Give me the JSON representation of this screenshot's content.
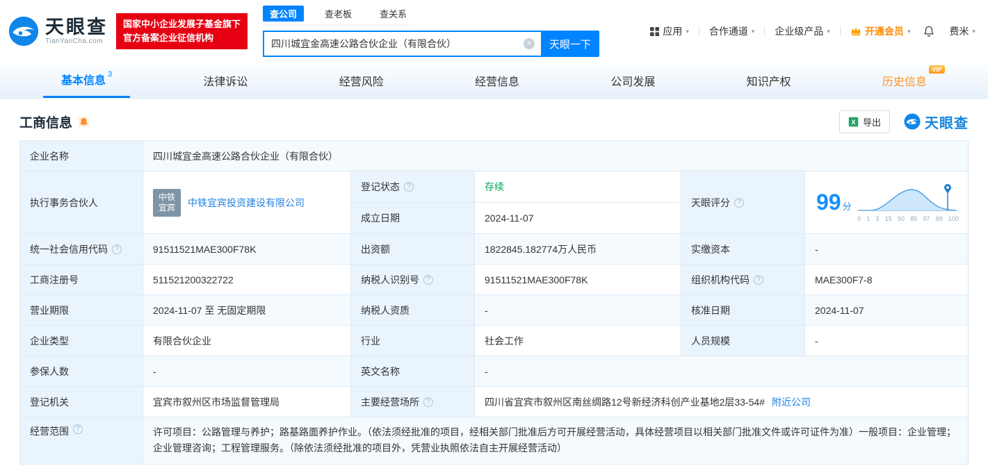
{
  "colors": {
    "brand_blue": "#0084ff",
    "link_blue": "#2382e0",
    "status_green": "#00a854",
    "badge_red": "#e60012",
    "vip_orange": "#ff9423"
  },
  "icons": {
    "caret_down": "▾",
    "clear": "×",
    "help": "?"
  },
  "header": {
    "logo": {
      "title": "天眼查",
      "subtitle": "TianYanCha.com"
    },
    "badge": {
      "line1": "国家中小企业发展子基金旗下",
      "line2": "官方备案企业征信机构"
    },
    "search": {
      "tabs": [
        {
          "label": "查公司"
        },
        {
          "label": "查老板"
        },
        {
          "label": "查关系"
        }
      ],
      "value": "四川城宜金高速公路合伙企业（有限合伙）",
      "button": "天眼一下"
    },
    "nav": {
      "apps": "应用",
      "cooperation": "合作通道",
      "enterprise_products": "企业级产品",
      "vip": "开通会员",
      "username": "费米"
    }
  },
  "tabs": {
    "basic": {
      "label": "基本信息",
      "badge": "3"
    },
    "legal": {
      "label": "法律诉讼"
    },
    "risk": {
      "label": "经营风险"
    },
    "operation": {
      "label": "经营信息"
    },
    "development": {
      "label": "公司发展"
    },
    "ip": {
      "label": "知识产权"
    },
    "history": {
      "label": "历史信息",
      "vip_badge": "VIP"
    }
  },
  "section": {
    "title": "工商信息",
    "export_label": "导出",
    "brand": "天眼查"
  },
  "info": {
    "company_name": {
      "label": "企业名称",
      "value": "四川城宜金高速公路合伙企业（有限合伙）"
    },
    "partner": {
      "label": "执行事务合伙人",
      "logo_line1": "中铁",
      "logo_line2": "宜宾",
      "value": "中铁宜宾投资建设有限公司"
    },
    "reg_status": {
      "label": "登记状态",
      "value": "存续"
    },
    "est_date": {
      "label": "成立日期",
      "value": "2024-11-07"
    },
    "score": {
      "label": "天眼评分",
      "value": "99",
      "unit": "分",
      "ticks": [
        "0",
        "1",
        "3",
        "15",
        "50",
        "85",
        "97",
        "99",
        "100"
      ]
    },
    "credit_code": {
      "label": "统一社会信用代码",
      "value": "91511521MAE300F78K"
    },
    "capital": {
      "label": "出资额",
      "value": "1822845.182774万人民币"
    },
    "paid_capital": {
      "label": "实缴资本",
      "value": "-"
    },
    "reg_number": {
      "label": "工商注册号",
      "value": "511521200322722"
    },
    "taxpayer_id": {
      "label": "纳税人识别号",
      "value": "91511521MAE300F78K"
    },
    "org_code": {
      "label": "组织机构代码",
      "value": "MAE300F7-8"
    },
    "business_term": {
      "label": "营业期限",
      "value": "2024-11-07 至 无固定期限"
    },
    "taxpayer_quality": {
      "label": "纳税人资质",
      "value": "-"
    },
    "approval_date": {
      "label": "核准日期",
      "value": "2024-11-07"
    },
    "company_type": {
      "label": "企业类型",
      "value": "有限合伙企业"
    },
    "industry": {
      "label": "行业",
      "value": "社会工作"
    },
    "staff_size": {
      "label": "人员规模",
      "value": "-"
    },
    "insured_count": {
      "label": "参保人数",
      "value": "-"
    },
    "english_name": {
      "label": "英文名称",
      "value": "-"
    },
    "reg_authority": {
      "label": "登记机关",
      "value": "宜宾市叙州区市场监督管理局"
    },
    "address": {
      "label": "主要经营场所",
      "value": "四川省宜宾市叙州区南丝绸路12号新经济科创产业基地2层33-54#",
      "nearby_link": "附近公司"
    },
    "business_scope": {
      "label": "经营范围",
      "value": "许可项目：公路管理与养护；路基路面养护作业。（依法须经批准的项目，经相关部门批准后方可开展经营活动，具体经营项目以相关部门批准文件或许可证件为准）一般项目：企业管理；企业管理咨询；工程管理服务。（除依法须经批准的项目外，凭营业执照依法自主开展经营活动）"
    }
  }
}
